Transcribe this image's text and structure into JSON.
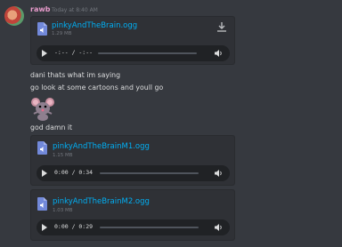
{
  "author": {
    "name": "rawb",
    "timestamp": "Today at 8:40 AM"
  },
  "messages": [
    "dani thats what im saying",
    "go look at some cartoons and youll go",
    "god damn it"
  ],
  "attachments": [
    {
      "name": "pinkyAndTheBrain.ogg",
      "size": "1.29 MB",
      "time": "-:-- / -:--"
    },
    {
      "name": "pinkyAndTheBrainM1.ogg",
      "size": "1.15 MB",
      "time": "0:00 / 0:34"
    },
    {
      "name": "pinkyAndTheBrainM2.ogg",
      "size": "1.03 MB",
      "time": "0:00 / 0:29"
    }
  ],
  "emoji": {
    "icon": "pinky-mouse-emoji"
  },
  "colors": {
    "background": "#36393f",
    "username": "#e79bcb",
    "link": "#00aff4",
    "file_icon": "#7289da"
  }
}
